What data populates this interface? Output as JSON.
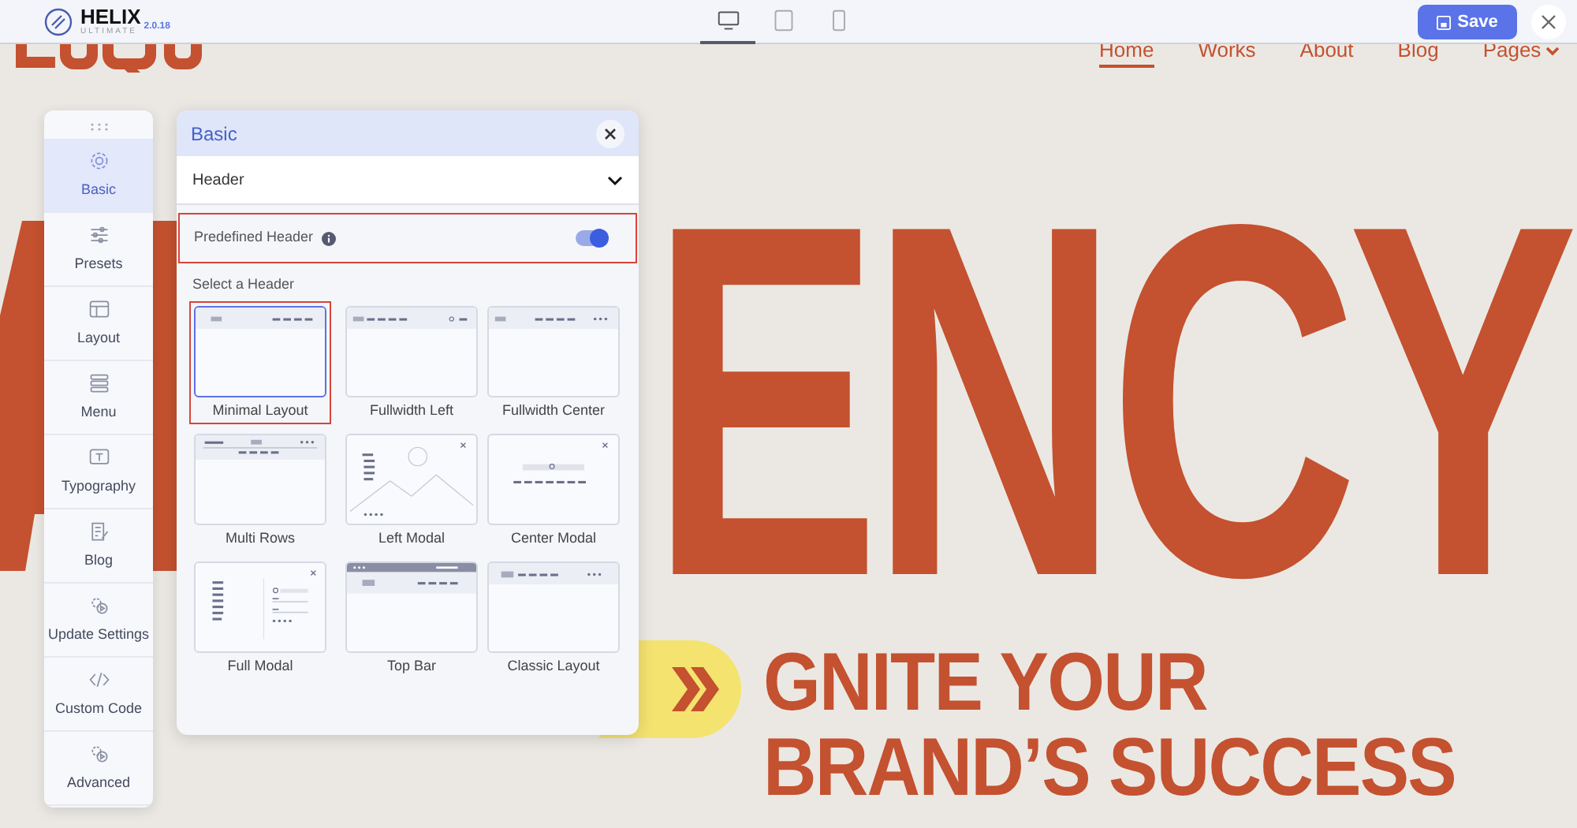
{
  "app": {
    "name": "HELIX",
    "edition": "ULTIMATE",
    "version": "2.0.18"
  },
  "devices": [
    {
      "selected": true
    },
    {
      "selected": false
    },
    {
      "selected": false
    }
  ],
  "save_button": "Save",
  "site_nav": [
    {
      "label": "Home",
      "selected": true,
      "dropdown": false
    },
    {
      "label": "Works",
      "selected": false,
      "dropdown": false
    },
    {
      "label": "About",
      "selected": false,
      "dropdown": false
    },
    {
      "label": "Blog",
      "selected": false,
      "dropdown": false
    },
    {
      "label": "Pages",
      "selected": false,
      "dropdown": true
    }
  ],
  "hero_heading": "ENCY",
  "tagline": [
    "GNITE YOUR",
    "BRAND’S SUCCESS"
  ],
  "sidebar": {
    "items": [
      {
        "label": "Basic",
        "selected": true
      },
      {
        "label": "Presets",
        "selected": false
      },
      {
        "label": "Layout",
        "selected": false
      },
      {
        "label": "Menu",
        "selected": false
      },
      {
        "label": "Typography",
        "selected": false
      },
      {
        "label": "Blog",
        "selected": false
      },
      {
        "label": "Update Settings",
        "selected": false
      },
      {
        "label": "Custom Code",
        "selected": false
      },
      {
        "label": "Advanced",
        "selected": false
      }
    ]
  },
  "panel": {
    "title": "Basic",
    "section": "Header",
    "toggle": {
      "label": "Predefined Header",
      "on": true,
      "highlighted": true
    },
    "select_label": "Select a Header",
    "layouts": [
      {
        "label": "Minimal Layout",
        "kind": "minimal",
        "selected": true,
        "highlighted": true
      },
      {
        "label": "Fullwidth Left",
        "kind": "fullleft",
        "selected": false,
        "highlighted": false
      },
      {
        "label": "Fullwidth Center",
        "kind": "fullcenter",
        "selected": false,
        "highlighted": false
      },
      {
        "label": "Multi Rows",
        "kind": "multirows",
        "selected": false,
        "highlighted": false
      },
      {
        "label": "Left Modal",
        "kind": "leftmodal",
        "selected": false,
        "highlighted": false
      },
      {
        "label": "Center Modal",
        "kind": "centermodal",
        "selected": false,
        "highlighted": false
      },
      {
        "label": "Full Modal",
        "kind": "fullmodal",
        "selected": false,
        "highlighted": false
      },
      {
        "label": "Top Bar",
        "kind": "topbar",
        "selected": false,
        "highlighted": false
      },
      {
        "label": "Classic Layout",
        "kind": "classic",
        "selected": false,
        "highlighted": false
      }
    ]
  }
}
